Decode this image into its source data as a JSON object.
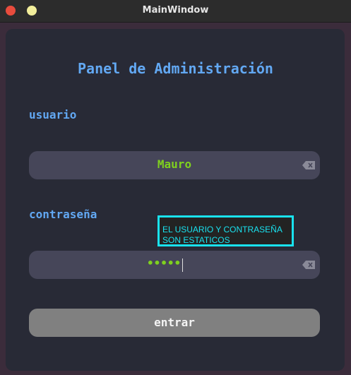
{
  "window": {
    "title": "MainWindow"
  },
  "panel": {
    "heading": "Panel de Administración"
  },
  "username": {
    "label": "usuario",
    "value": "Mauro"
  },
  "password": {
    "label": "contraseña",
    "masked_value": "•••••"
  },
  "tooltip": {
    "text_line1": "EL USUARIO Y CONTRASEÑA",
    "text_line2": "SON ESTATICOS"
  },
  "enter_button": {
    "label": "entrar"
  },
  "icons": {
    "close": "close-window-icon",
    "minimize": "minimize-window-icon",
    "clear": "clear-input-icon"
  },
  "colors": {
    "label_blue": "#62a8f3",
    "value_green": "#7fd11f",
    "tooltip_cyan": "#19e2ef",
    "button_gray": "#808080",
    "panel_bg": "#282a36"
  }
}
